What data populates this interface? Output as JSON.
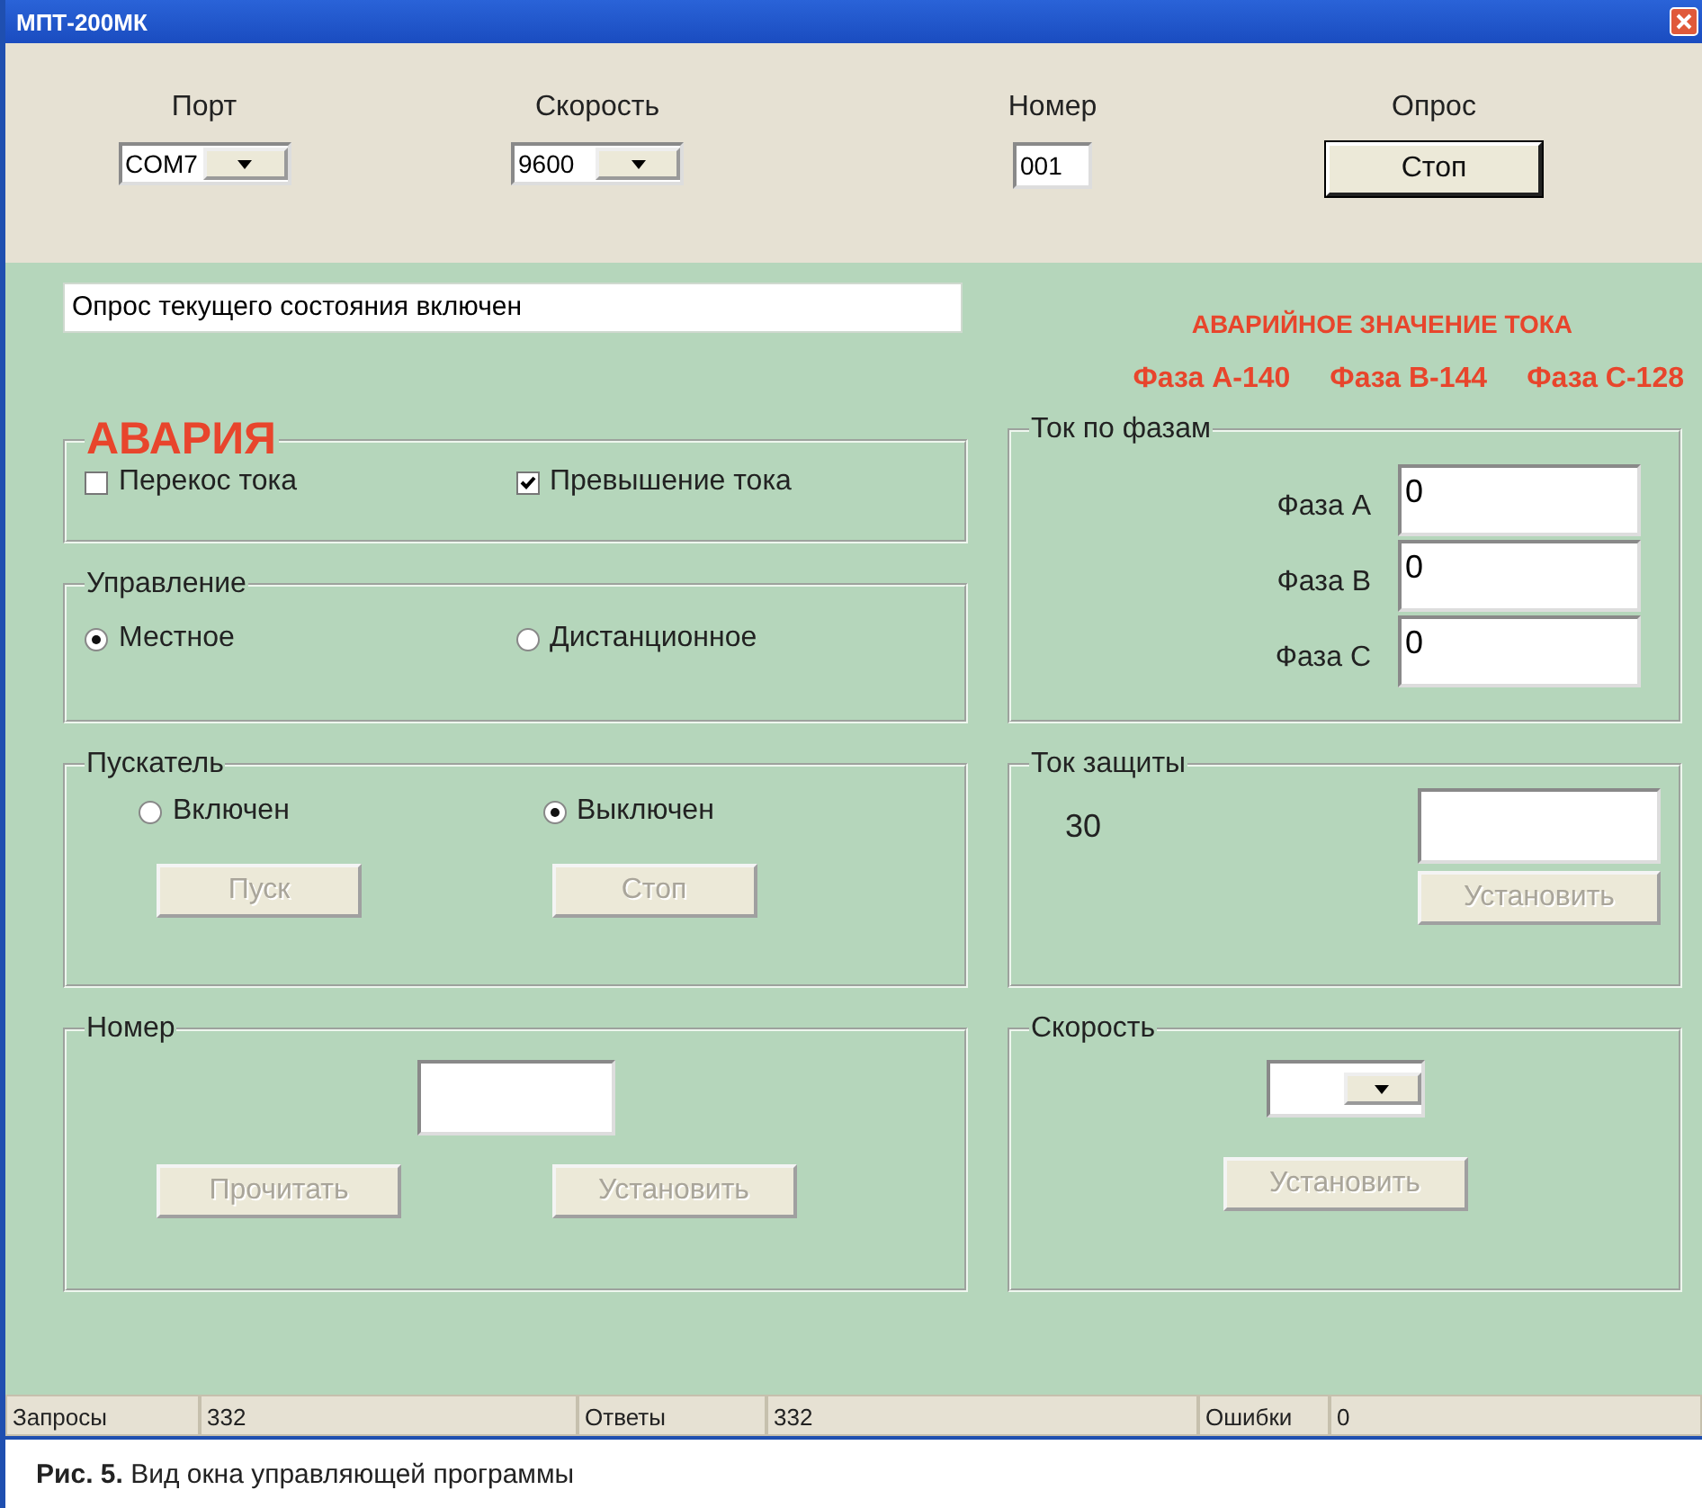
{
  "window": {
    "title": "МПТ-200МК"
  },
  "toolbar": [
    {
      "kind": "combo",
      "label": "Порт",
      "value": "COM7"
    },
    {
      "kind": "combo",
      "label": "Скорость",
      "value": "9600"
    },
    {
      "kind": "field",
      "label": "Номер",
      "value": "001"
    },
    {
      "kind": "button",
      "label": "Опрос",
      "value": "Стоп"
    }
  ],
  "status_message": "Опрос текущего состояния включен",
  "alarm": {
    "heading": "АВАРИЙНОЕ ЗНАЧЕНИЕ ТОКА",
    "phases": [
      "Фаза А-140",
      "Фаза В-144",
      "Фаза С-128"
    ]
  },
  "fault": {
    "title": "АВАРИЯ",
    "checks": [
      {
        "label": "Перекос тока",
        "checked": false
      },
      {
        "label": "Превышение тока",
        "checked": true
      }
    ]
  },
  "control": {
    "title": "Управление",
    "options": [
      {
        "label": "Местное",
        "selected": true
      },
      {
        "label": "Дистанционное",
        "selected": false
      }
    ]
  },
  "starter": {
    "title": "Пускатель",
    "options": [
      {
        "label": "Включен",
        "selected": false
      },
      {
        "label": "Выключен",
        "selected": true
      }
    ],
    "buttons": [
      {
        "label": "Пуск",
        "disabled": true
      },
      {
        "label": "Стоп",
        "disabled": true
      }
    ]
  },
  "number": {
    "title": "Номер",
    "buttons": [
      {
        "label": "Прочитать",
        "disabled": true
      },
      {
        "label": "Установить",
        "disabled": true
      }
    ]
  },
  "phase_current": {
    "title": "Ток по фазам",
    "rows": [
      {
        "label": "Фаза А",
        "value": "0"
      },
      {
        "label": "Фаза В",
        "value": "0"
      },
      {
        "label": "Фаза С",
        "value": "0"
      }
    ]
  },
  "protection": {
    "title": "Ток защиты",
    "value": "30",
    "button": {
      "label": "Установить",
      "disabled": true
    }
  },
  "speed": {
    "title": "Скорость",
    "button": {
      "label": "Установить",
      "disabled": true
    }
  },
  "status_bar": [
    {
      "label": "Запросы",
      "value": "332"
    },
    {
      "label": "Ответы",
      "value": "332"
    },
    {
      "label": "Ошибки",
      "value": "0"
    }
  ],
  "caption": "**Рис. 5.** Вид окна управляющей программы"
}
